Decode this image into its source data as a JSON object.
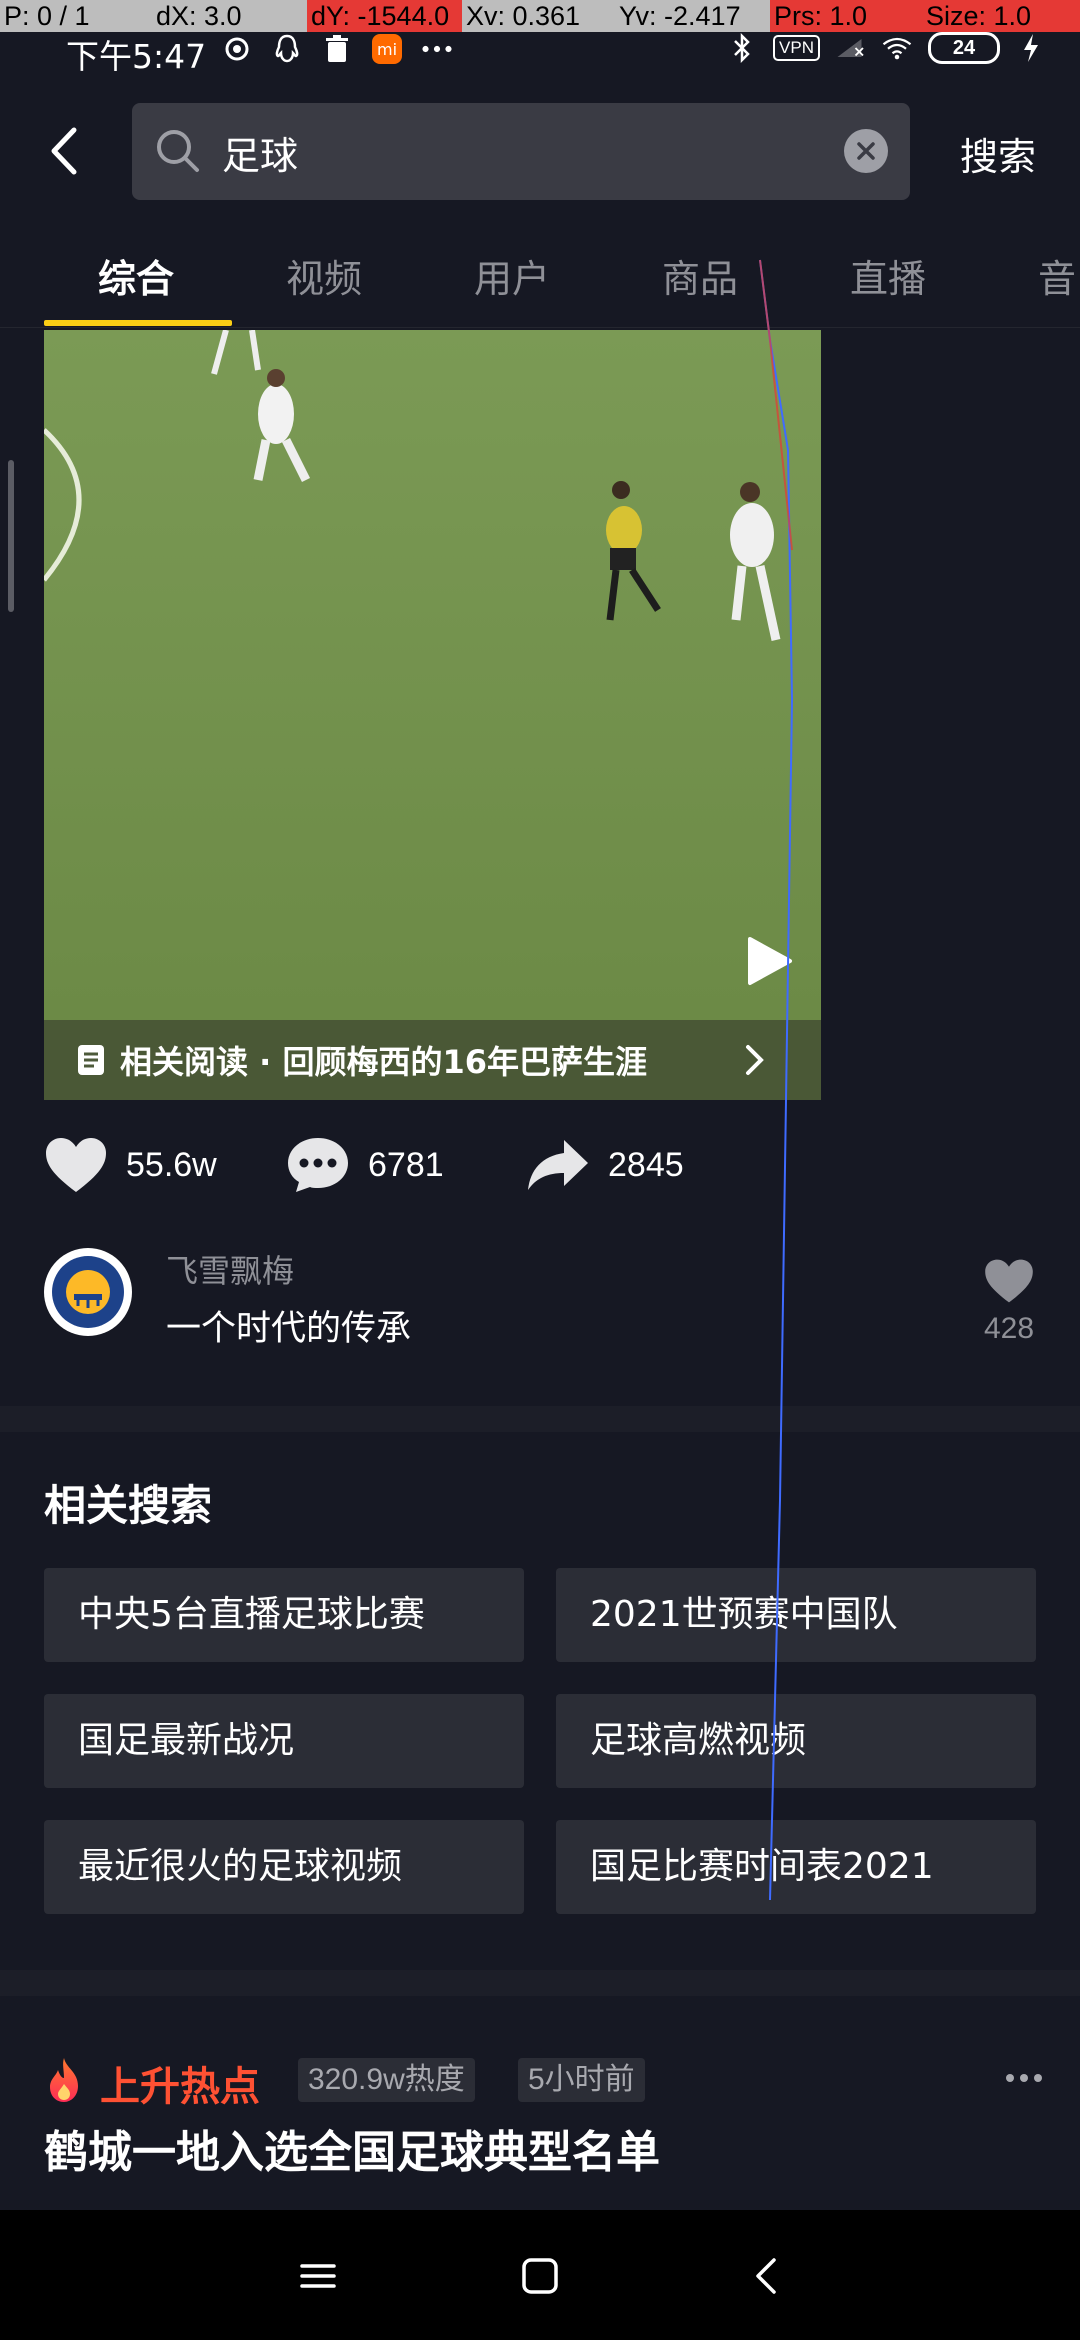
{
  "debug": {
    "pointer": "P: 0 / 1",
    "dx": "dX: 3.0",
    "dy": "dY: -1544.0",
    "xv": "Xv: 0.361",
    "yv": "Yv: -2.417",
    "prs": "Prs: 1.0",
    "size": "Size: 1.0"
  },
  "status_bar": {
    "time": "下午5:47",
    "vpn": "VPN",
    "battery": "24",
    "mi": "mi"
  },
  "search": {
    "query": "足球",
    "submit_label": "搜索"
  },
  "tabs": [
    {
      "label": "综合",
      "active": true
    },
    {
      "label": "视频"
    },
    {
      "label": "用户"
    },
    {
      "label": "商品"
    },
    {
      "label": "直播"
    },
    {
      "label": "音"
    }
  ],
  "video": {
    "related_text": "相关阅读 · 回顾梅西的16年巴萨生涯"
  },
  "actions": {
    "likes": "55.6w",
    "comments": "6781",
    "shares": "2845"
  },
  "top_comment": {
    "user": "飞雪飘梅",
    "text": "一个时代的传承",
    "likes": "428"
  },
  "related_searches": {
    "title": "相关搜索",
    "items": [
      "中央5台直播足球比赛",
      "2021世预赛中国队",
      "国足最新战况",
      "足球高燃视频",
      "最近很火的足球视频",
      "国足比赛时间表2021"
    ]
  },
  "hot_topic": {
    "label": "上升热点",
    "heat": "320.9w热度",
    "time": "5小时前",
    "title": "鹤城一地入选全国足球典型名单"
  },
  "colors": {
    "background": "#161823",
    "tab_accent": "#face15",
    "hot_red": "#fe5133"
  }
}
